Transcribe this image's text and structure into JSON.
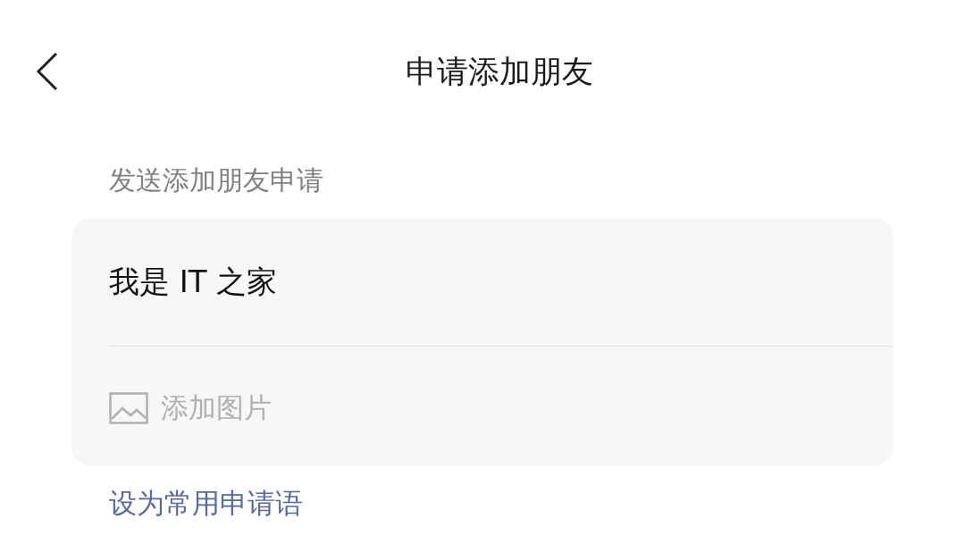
{
  "title": "申请添加朋友",
  "section_label": "发送添加朋友申请",
  "message": {
    "value": "我是 IT 之家"
  },
  "add_image": {
    "label": "添加图片"
  },
  "link": "设为常用申请语"
}
